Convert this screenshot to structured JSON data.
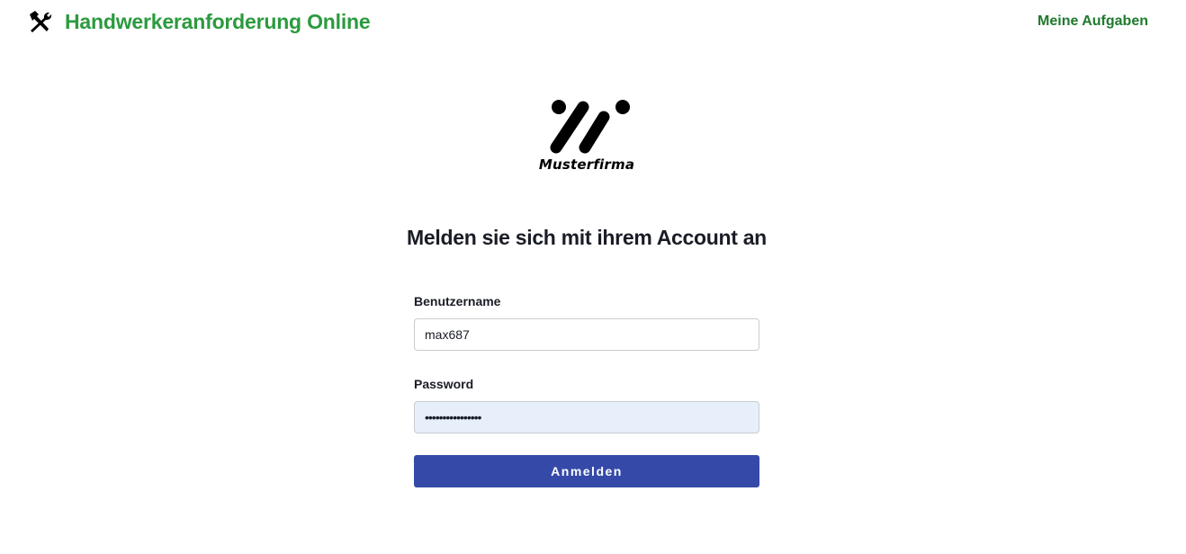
{
  "header": {
    "app_title": "Handwerkeranforderung Online",
    "app_icon": "hammer-wrench-icon",
    "nav_link": "Meine Aufgaben",
    "brand_color": "#2b9a3e"
  },
  "logo": {
    "company_name": "Musterfirma"
  },
  "login": {
    "title": "Melden sie sich mit ihrem Account an",
    "username_label": "Benutzername",
    "username_value": "max687",
    "password_label": "Password",
    "password_value": "••••••••••••••••",
    "submit_label": "Anmelden",
    "submit_color": "#354aa8"
  }
}
